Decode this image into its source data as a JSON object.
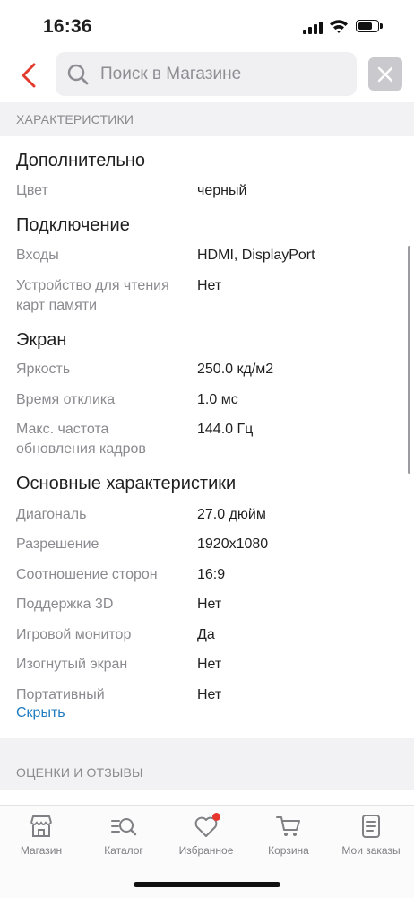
{
  "status_bar": {
    "time": "16:36"
  },
  "search": {
    "placeholder": "Поиск в Магазине",
    "value": ""
  },
  "sections": {
    "characteristics_title": "ХАРАКТЕРИСТИКИ",
    "reviews_title": "ОЦЕНКИ И ОТЗЫВЫ"
  },
  "groups": [
    {
      "title": "Дополнительно",
      "props": [
        {
          "label": "Цвет",
          "value": "черный"
        }
      ]
    },
    {
      "title": "Подключение",
      "props": [
        {
          "label": "Входы",
          "value": "HDMI, DisplayPort"
        },
        {
          "label": "Устройство для чтения карт памяти",
          "value": "Нет"
        }
      ]
    },
    {
      "title": "Экран",
      "props": [
        {
          "label": "Яркость",
          "value": "250.0 кд/м2"
        },
        {
          "label": "Время отклика",
          "value": "1.0 мс"
        },
        {
          "label": "Макс. частота обновления кадров",
          "value": "144.0 Гц"
        }
      ]
    },
    {
      "title": "Основные характеристики",
      "props": [
        {
          "label": "Диагональ",
          "value": "27.0 дюйм"
        },
        {
          "label": "Разрешение",
          "value": "1920x1080"
        },
        {
          "label": "Соотношение сторон",
          "value": "16:9"
        },
        {
          "label": "Поддержка 3D",
          "value": "Нет"
        },
        {
          "label": "Игровой монитор",
          "value": "Да"
        },
        {
          "label": "Изогнутый экран",
          "value": "Нет"
        },
        {
          "label": "Портативный",
          "value": "Нет"
        }
      ]
    }
  ],
  "hide_link": "Скрыть",
  "tabs": [
    {
      "label": "Магазин",
      "icon": "store-icon"
    },
    {
      "label": "Каталог",
      "icon": "catalog-search-icon"
    },
    {
      "label": "Избранное",
      "icon": "heart-icon"
    },
    {
      "label": "Корзина",
      "icon": "cart-icon"
    },
    {
      "label": "Мои заказы",
      "icon": "orders-icon"
    }
  ],
  "colors": {
    "accent": "#e8352f",
    "link": "#1f7cbf",
    "muted": "#8a8a8f"
  }
}
